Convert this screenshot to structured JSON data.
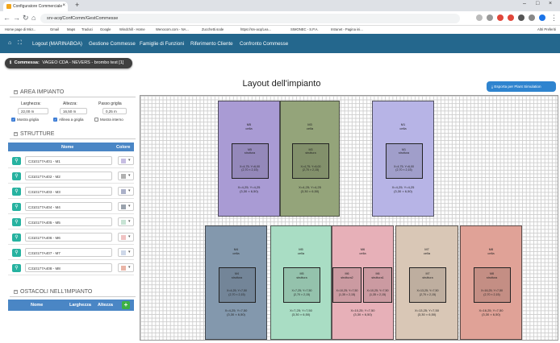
{
  "browser": {
    "tab_title": "Configuratore Commerciale",
    "new_tab": "+",
    "url": "srv-acq/ConfComm/GestCommesse",
    "bookmarks": [
      "Home page di Micr...",
      "Gmail",
      "Maps",
      "Traduci",
      "Google",
      "Windchill - Home",
      "Wenocom.com - NA...",
      "Zucchetti.sode",
      "https://srv-acq/Lea...",
      "SIMONEC - S.P.A.",
      "Intranet - Pagina ini..."
    ],
    "bookmarks_right": "Altri Preferiti"
  },
  "nav": {
    "home_icon": "home-icon",
    "logout": "Logout (MARINABOA)",
    "items": [
      "Gestione Commesse",
      "Famiglie di Funzioni",
      "Riferimento Cliente",
      "Confronto Commesse"
    ]
  },
  "commessa": {
    "label": "Commessa:",
    "value": "VAGEO CDA - NEVERS - brombo test [1]"
  },
  "area": {
    "title": "AREA IMPIANTO",
    "larghezza_label": "Larghezza:",
    "larghezza_value": "22,00 m",
    "altezza_label": "Altezza:",
    "altezza_value": "16,50 m",
    "passo_label": "Passo griglia",
    "passo_value": "0,25 m",
    "mostra_griglia": "Mostra griglia",
    "allinea_griglia": "Allinea a griglia",
    "mostra_interno": "Mostra interno"
  },
  "strutture": {
    "title": "STRUTTURE",
    "col_nome": "Nome",
    "col_colore": "Colore",
    "rows": [
      {
        "name": "C310177A401 - M1",
        "color": "#c6bde2"
      },
      {
        "name": "C310177A402 - M2",
        "color": "#b0b0b0"
      },
      {
        "name": "C310177A403 - M3",
        "color": "#aab0c8"
      },
      {
        "name": "C310177A404 - M4",
        "color": "#9aa2ad"
      },
      {
        "name": "C310177A405 - M5",
        "color": "#c7e3d4"
      },
      {
        "name": "C310177A406 - M6",
        "color": "#f0c3c3"
      },
      {
        "name": "C310177A407 - M7",
        "color": "#cdd7e8"
      },
      {
        "name": "C310177A408 - M8",
        "color": "#e9b4a6"
      }
    ]
  },
  "ostacoli": {
    "title": "OSTACOLI NELL'IMPIANTO",
    "col_nome": "Nome",
    "col_larghezza": "Larghezza",
    "col_altezza": "Altezza",
    "add": "+"
  },
  "layout": {
    "title": "Layout dell'impianto",
    "export_button": "Esporta per Plant Simulation"
  },
  "cells": [
    {
      "name": "M5",
      "cell_label": "cella",
      "fill": "#a99bd4",
      "struct_name": "M5",
      "struct_label": "struttura",
      "struct_dims": "X=4,75; Y=6,00\n(2,70 × 2,15)",
      "cell_dims": "X=4,25; Y=4,25\n(3,30 × 6,50)"
    },
    {
      "name": "M3",
      "cell_label": "cella",
      "fill": "#94a47a",
      "struct_name": "M3",
      "struct_label": "struttura",
      "struct_dims": "X=4,75; Y=6,00\n(2,70 × 2,15)",
      "cell_dims": "X=4,25; Y=4,25\n(3,30 × 6,50)"
    },
    {
      "name": "M1",
      "cell_label": "cella",
      "fill": "#b7b4e6",
      "struct_name": "M1",
      "struct_label": "struttura",
      "struct_dims": "X=4,75; Y=6,00\n(2,70 × 2,15)",
      "cell_dims": "X=4,25; Y=4,25\n(3,30 × 6,50)"
    },
    {
      "name": "M4",
      "cell_label": "cella",
      "fill": "#8398ad",
      "struct_name": "M4",
      "struct_label": "struttura",
      "struct_dims": "X=4,25; Y=7,50\n(2,70 × 2,15)",
      "cell_dims": "X=4,25; Y=7,50\n(3,30 × 6,50)"
    },
    {
      "name": "M5",
      "cell_label": "cella",
      "fill": "#a9ddc4",
      "struct_name": "M5",
      "struct_label": "struttura",
      "struct_dims": "X=7,25; Y=7,50\n(2,70 × 2,15)",
      "cell_dims": "X=7,25; Y=7,50\n(3,30 × 6,50)"
    },
    {
      "name": "M6",
      "cell_label": "cella",
      "fill": "#e7b0b8",
      "struct_name": "M6",
      "struct_label": "struttura2",
      "struct_name_b": "M6",
      "struct_label_b": "struttura1",
      "struct_dims": "X=10,25; Y=7,50\n(1,35 × 2,15)",
      "cell_dims": "X=10,25; Y=7,50\n(3,30 × 6,50)"
    },
    {
      "name": "M7",
      "cell_label": "cella",
      "fill": "#d9c7b6",
      "struct_name": "M7",
      "struct_label": "struttura",
      "struct_dims": "X=13,25; Y=7,50\n(2,70 × 2,15)",
      "cell_dims": "X=13,25; Y=7,50\n(3,30 × 6,50)"
    },
    {
      "name": "M8",
      "cell_label": "cella",
      "fill": "#e0a297",
      "struct_name": "M8",
      "struct_label": "struttura",
      "struct_dims": "X=16,25; Y=7,50\n(2,70 × 2,15)",
      "cell_dims": "X=16,25; Y=7,50\n(3,30 × 6,50)"
    }
  ]
}
